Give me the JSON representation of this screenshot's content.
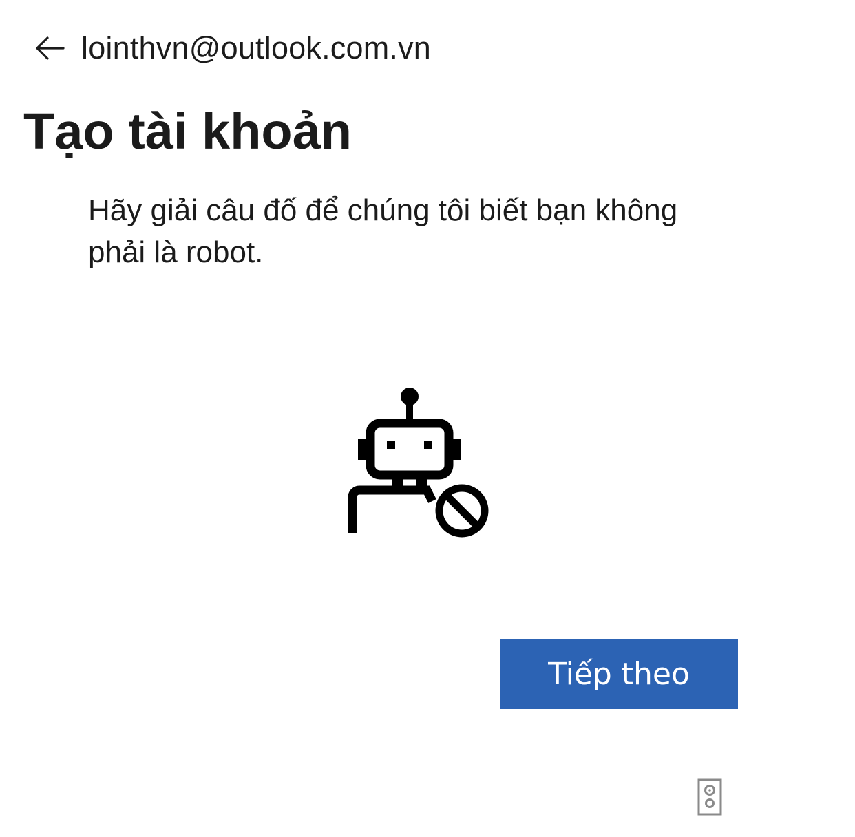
{
  "header": {
    "back_icon": "arrow-left-icon",
    "email": "lointhvn@outlook.com.vn"
  },
  "main": {
    "title": "Tạo tài khoản",
    "instruction": "Hãy giải câu đố để chúng tôi biết bạn không phải là robot.",
    "illustration_icon": "robot-blocked-icon",
    "next_button_label": "Tiếp theo"
  },
  "footer": {
    "audio_icon": "speaker-icon"
  },
  "colors": {
    "accent": "#2c63b4",
    "text": "#1b1b1b",
    "background": "#ffffff"
  }
}
